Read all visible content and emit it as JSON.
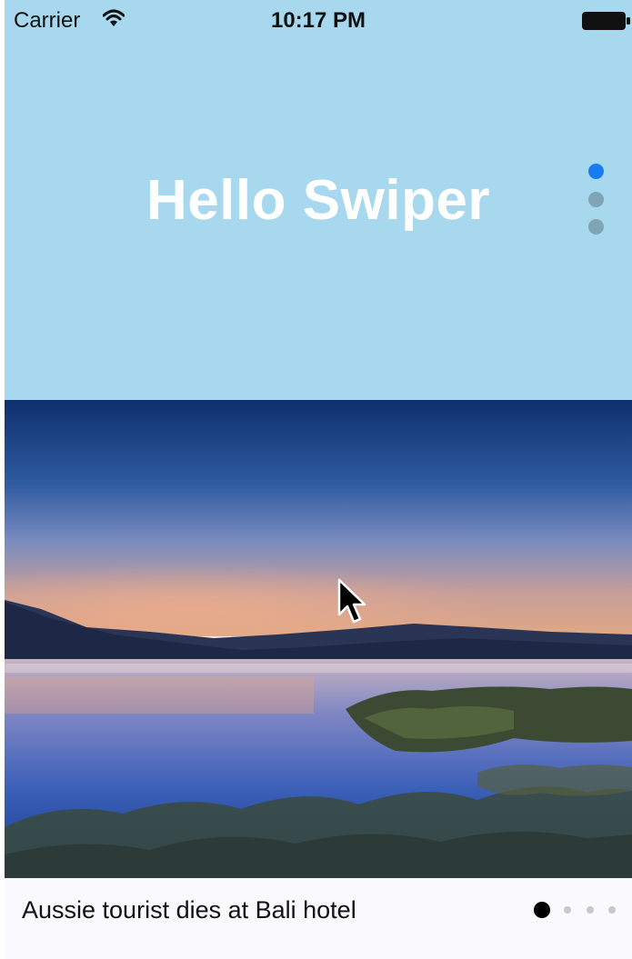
{
  "status_bar": {
    "carrier": "Carrier",
    "time": "10:17 PM",
    "icons": [
      "wifi-icon",
      "battery-icon"
    ]
  },
  "top_slider": {
    "title": "Hello Swiper",
    "background_color": "#a7d8ee",
    "pagination": {
      "count": 3,
      "active_index": 0,
      "active_color": "#1a7cf2",
      "inactive_color": "#7fa4b3"
    }
  },
  "image_slider": {
    "caption": "Aussie tourist dies at Bali hotel",
    "pagination": {
      "count": 4,
      "active_index": 0,
      "active_color": "#000000",
      "inactive_color": "#c8c8cc"
    }
  },
  "cursor": {
    "icon": "arrow-cursor-icon"
  }
}
